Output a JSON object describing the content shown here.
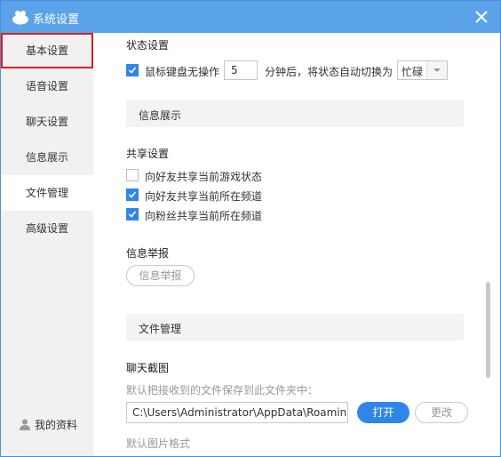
{
  "window": {
    "title": "系统设置",
    "accent": "#5aa3e8"
  },
  "sidebar": {
    "items": [
      {
        "label": "基本设置"
      },
      {
        "label": "语音设置"
      },
      {
        "label": "聊天设置"
      },
      {
        "label": "信息展示"
      },
      {
        "label": "文件管理"
      },
      {
        "label": "高级设置"
      }
    ],
    "profile_label": "我的资料"
  },
  "status": {
    "heading": "状态设置",
    "checkbox_label": "鼠标键盘无操作",
    "minutes_value": "5",
    "after_text": "分钟后，将状态自动切换为",
    "status_select": "忙碌"
  },
  "info_display": {
    "band_title": "信息展示",
    "share_heading": "共享设置",
    "options": [
      {
        "label": "向好友共享当前游戏状态",
        "checked": false
      },
      {
        "label": "向好友共享当前所在频道",
        "checked": true
      },
      {
        "label": "向粉丝共享当前所在频道",
        "checked": true
      }
    ],
    "report_heading": "信息举报",
    "report_button": "信息举报"
  },
  "file_mgmt": {
    "band_title": "文件管理",
    "screenshot_heading": "聊天截图",
    "save_hint": "默认把接收到的文件保存到此文件夹中：",
    "path_value": "C:\\Users\\Administrator\\AppData\\Roaming",
    "open_button": "打开",
    "change_button": "更改",
    "image_format_label": "默认图片格式"
  }
}
